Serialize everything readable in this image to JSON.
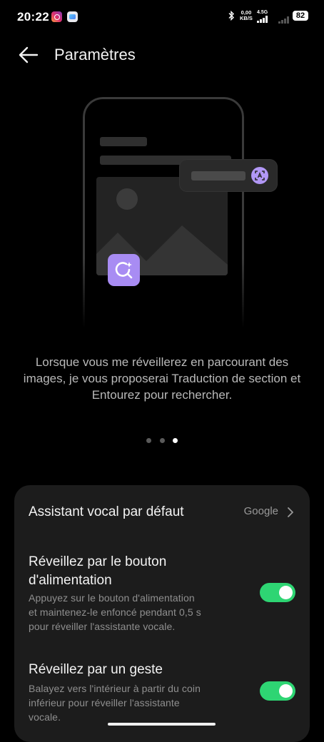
{
  "status_bar": {
    "time": "20:22",
    "net_speed_value": "0,00",
    "net_speed_unit": "KB/S",
    "network_type": "4.5G",
    "battery": "82"
  },
  "header": {
    "title": "Paramètres"
  },
  "description": "Lorsque vous me réveillerez en parcourant des images, je vous proposerai Traduction de section et Entourez pour rechercher.",
  "pager": {
    "count": 3,
    "active_index": 2
  },
  "settings": {
    "default_assistant": {
      "label": "Assistant vocal par défaut",
      "value": "Google"
    },
    "power_button": {
      "label_line1": "Réveillez par le bouton",
      "label_line2": "d'alimentation",
      "sub_line1": "Appuyez sur le bouton d'alimentation",
      "sub_line2": "et maintenez-le enfoncé pendant 0,5 s",
      "sub_line3": "pour réveiller l'assistante vocale.",
      "enabled": true
    },
    "gesture": {
      "label": "Réveillez par un geste",
      "sub_line1": "Balayez vers l'intérieur à partir du coin",
      "sub_line2": "inférieur pour réveiller l'assistante",
      "sub_line3": "vocale.",
      "enabled": true
    }
  },
  "colors": {
    "accent_toggle": "#2ed573",
    "accent_purple": "#a88cf3",
    "background": "#000000",
    "card": "#1c1c1c"
  },
  "icons": [
    "back-arrow-icon",
    "instagram-icon",
    "gallery-icon",
    "bluetooth-icon",
    "chevron-right-icon",
    "translate-icon",
    "circle-search-icon"
  ]
}
